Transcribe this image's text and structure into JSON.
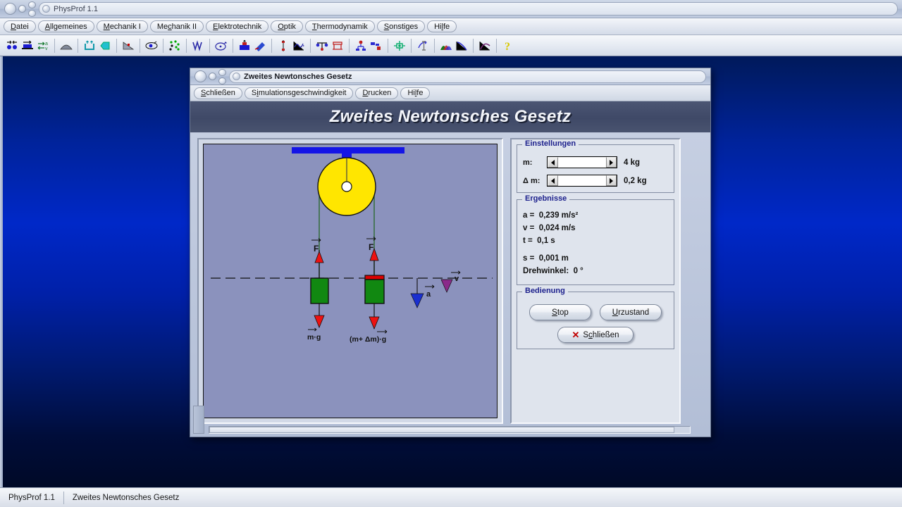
{
  "app": {
    "title": "PhysProf 1.1",
    "window_buttons": [
      "close-button",
      "minimize-button",
      "zoom-button"
    ],
    "menu": [
      {
        "label": "Datei",
        "accel": "D"
      },
      {
        "label": "Allgemeines",
        "accel": "A"
      },
      {
        "label": "Mechanik I",
        "accel": "M"
      },
      {
        "label": "Mechanik II",
        "accel": "c"
      },
      {
        "label": "Elektrotechnik",
        "accel": "E"
      },
      {
        "label": "Optik",
        "accel": "O"
      },
      {
        "label": "Thermodynamik",
        "accel": "T"
      },
      {
        "label": "Sonstiges",
        "accel": "S"
      },
      {
        "label": "Hilfe",
        "accel": "l"
      }
    ],
    "toolbar": [
      {
        "name": "two-bodies-collision-icon",
        "group": 1
      },
      {
        "name": "block-on-surface-icon",
        "group": 1
      },
      {
        "name": "acceleration-velocity-icon",
        "group": 1
      },
      {
        "name": "curve-hill-icon",
        "group": 2
      },
      {
        "name": "container-arrows-icon",
        "group": 3
      },
      {
        "name": "arrow-block-icon",
        "group": 3
      },
      {
        "name": "inclined-plane-icon",
        "group": 4
      },
      {
        "name": "pendulum-eye-icon",
        "group": 5
      },
      {
        "name": "particle-scatter-icon",
        "group": 6
      },
      {
        "name": "waveform-icon",
        "group": 7
      },
      {
        "name": "circular-motion-icon",
        "group": 8
      },
      {
        "name": "buoyancy-icon",
        "group": 9
      },
      {
        "name": "prism-refraction-icon",
        "group": 9
      },
      {
        "name": "spring-oscillation-icon",
        "group": 10
      },
      {
        "name": "damped-curve-icon",
        "group": 10
      },
      {
        "name": "balance-scale-icon",
        "group": 11
      },
      {
        "name": "bridge-load-icon",
        "group": 11
      },
      {
        "name": "pulley-system-icon",
        "group": 12
      },
      {
        "name": "lever-blocks-icon",
        "group": 12
      },
      {
        "name": "gear-transmission-icon",
        "group": 13
      },
      {
        "name": "torsion-icon",
        "group": 14
      },
      {
        "name": "gauss-distribution-icon",
        "group": 15
      },
      {
        "name": "decay-curve-icon",
        "group": 15
      },
      {
        "name": "peak-curve-icon",
        "group": 16
      },
      {
        "name": "help-icon",
        "group": 17
      }
    ]
  },
  "dialog": {
    "title": "Zweites Newtonsches Gesetz",
    "banner_title": "Zweites Newtonsches Gesetz",
    "menu": [
      {
        "label": "Schließen",
        "accel": "S"
      },
      {
        "label": "Simulationsgeschwindigkeit",
        "accel": "i"
      },
      {
        "label": "Drucken",
        "accel": "D"
      },
      {
        "label": "Hilfe",
        "accel": "l"
      }
    ],
    "settings": {
      "legend": "Einstellungen",
      "rows": [
        {
          "label": "m:",
          "value": "4 kg"
        },
        {
          "label": "Δ m:",
          "value": "0,2 kg"
        }
      ]
    },
    "results": {
      "legend": "Ergebnisse",
      "lines": [
        "a =  0,239 m/s²",
        "v =  0,024 m/s",
        "t =  0,1 s",
        "s =  0,001 m",
        "Drehwinkel:  0 °"
      ]
    },
    "controls": {
      "legend": "Bedienung",
      "stop_label": "Stop",
      "stop_accel": "S",
      "reset_label": "Urzustand",
      "reset_accel": "U",
      "close_label": "Schließen",
      "close_accel": "c",
      "close_icon": "x-mark-icon"
    },
    "simulation": {
      "name": "atwood-machine-simulation",
      "labels": {
        "force_left": "F",
        "force_right": "F",
        "weight_left": "m·g",
        "weight_right": "(m+ Δm)·g",
        "acceleration": "a",
        "velocity": "v"
      },
      "colors": {
        "canvas_bg": "#8b92bd",
        "pulley": "#ffe600",
        "mount_bar": "#1414e6",
        "mass_block": "#118811",
        "delta_mass": "#dd0000",
        "force_arrow": "#ee1111",
        "rope": "#2d6b34",
        "accel_arrow": "#1a2fd0",
        "velocity_arrow": "#8a2a8a"
      }
    }
  },
  "statusbar": {
    "app_name": "PhysProf 1.1",
    "context": "Zweites Newtonsches Gesetz"
  }
}
